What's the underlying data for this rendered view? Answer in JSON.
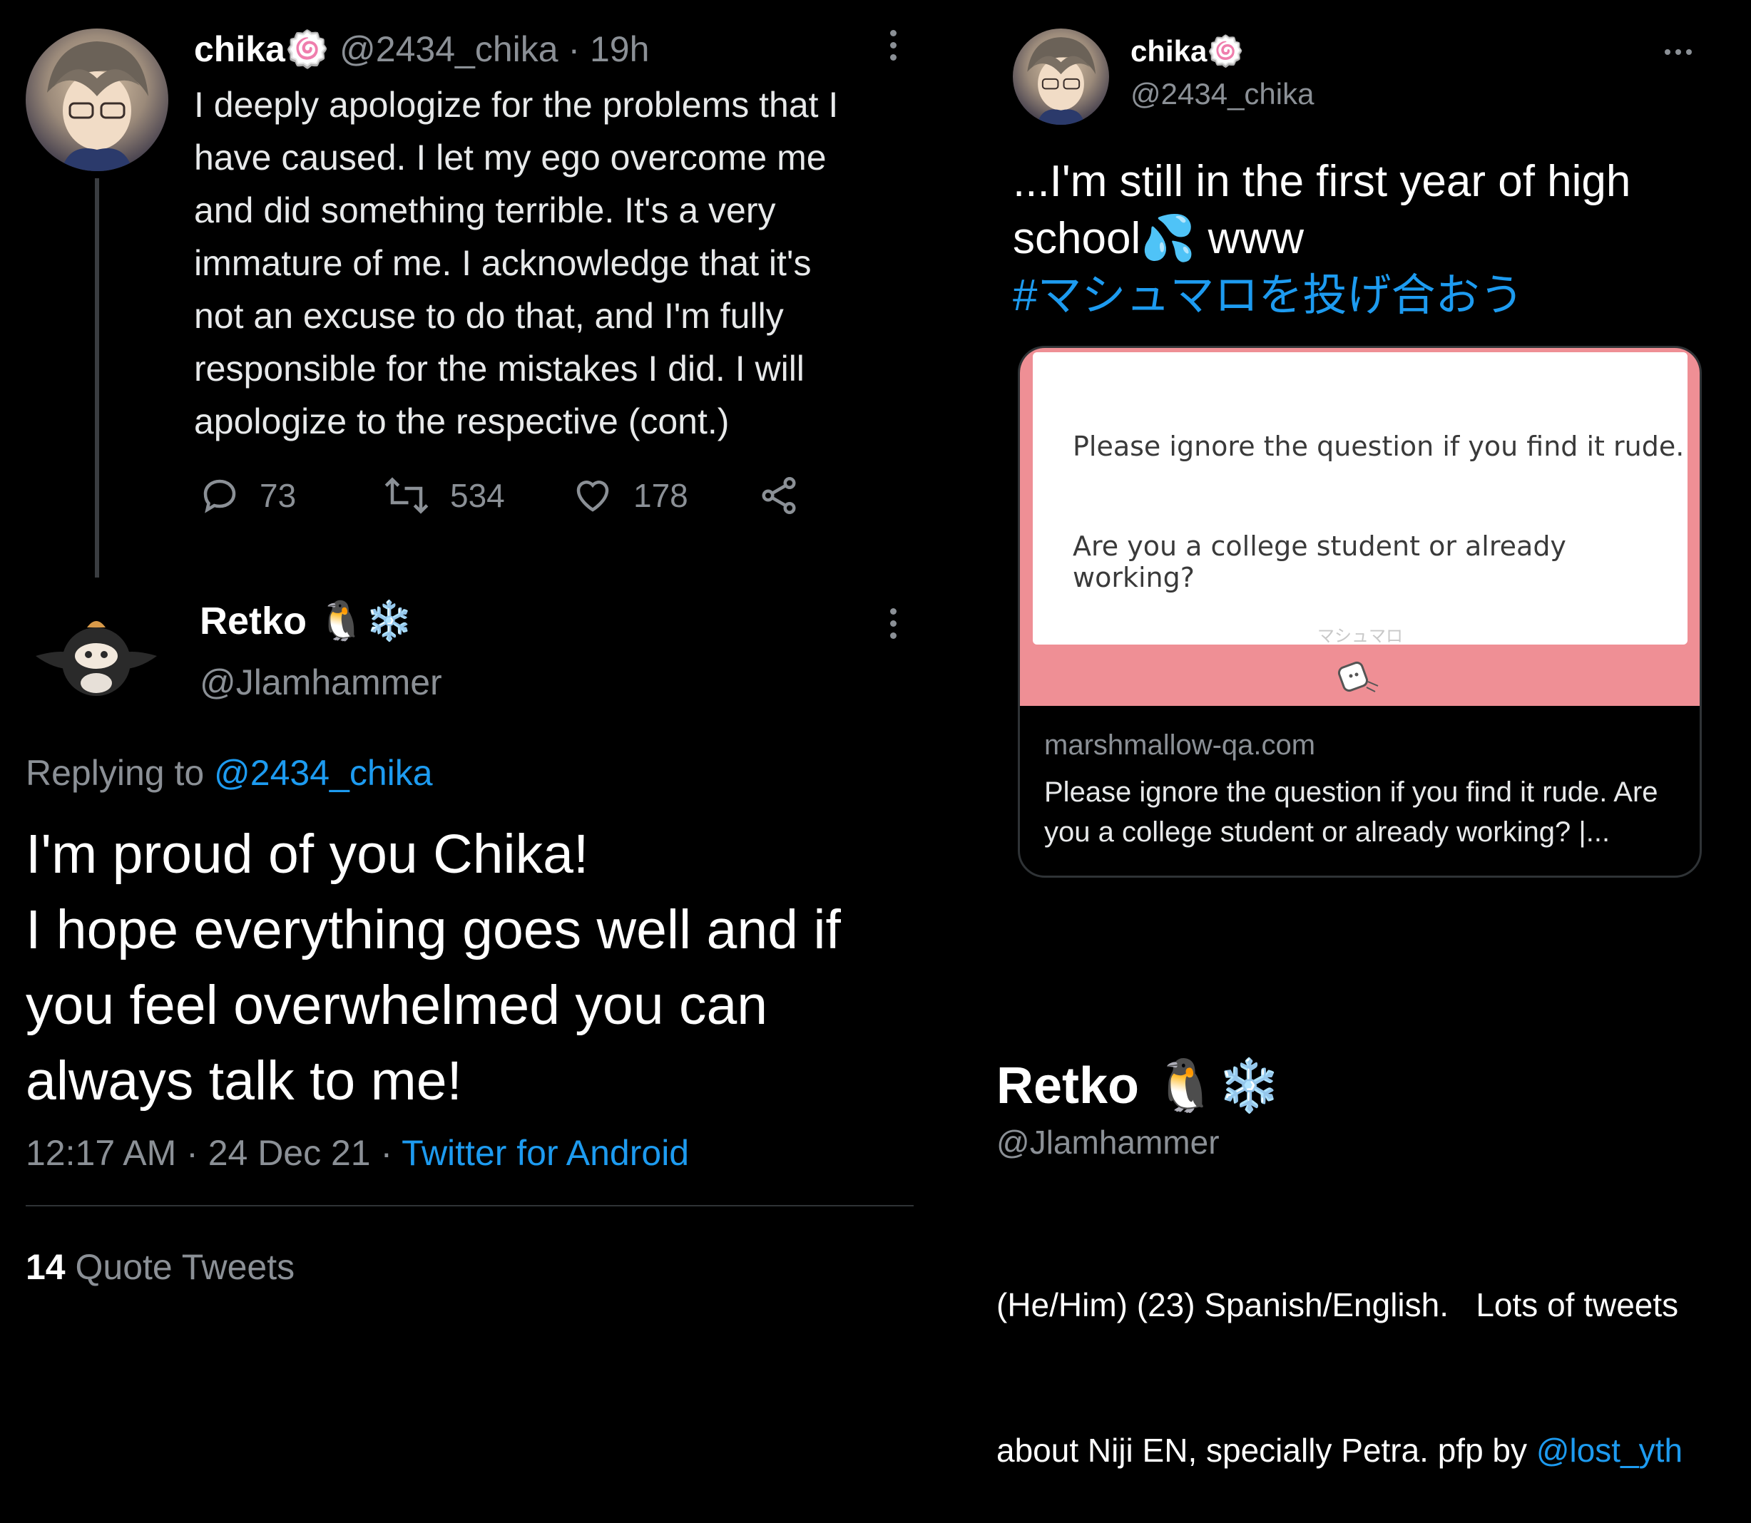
{
  "left_tweet": {
    "author_name": "chika",
    "author_emoji": "🍥",
    "handle": "@2434_chika",
    "time": " · 19h",
    "text_lines": [
      "I deeply apologize for the problems that I",
      "have caused. I let my ego overcome me",
      "and did something terrible. It's a very",
      "immature of me. I acknowledge that it's",
      "not an excuse to do that, and I'm fully",
      "responsible for the mistakes I did. I will",
      "apologize to the respective (cont.)"
    ],
    "replies": "73",
    "retweets": "534",
    "likes": "178"
  },
  "reply_tweet": {
    "author_name": "Retko",
    "author_emojis": "🐧❄️",
    "handle": "@Jlamhammer",
    "replying_prefix": "Replying to ",
    "replying_handle": "@2434_chika",
    "text_lines": [
      "I'm proud of you Chika!",
      "I hope everything goes well and if",
      "you feel overwhelmed you can",
      "always talk to me!"
    ],
    "timestamp": "12:17 AM · 24 Dec 21 · ",
    "client": "Twitter for Android",
    "quote_count": "14",
    "quote_label": " Quote Tweets"
  },
  "right_tweet": {
    "author_name": "chika",
    "author_emoji": "🍥",
    "handle": "@2434_chika",
    "text_line1": "...I'm still in the first year of high",
    "text_line2_a": "school",
    "text_line2_emoji": "💦",
    "text_line2_b": " www",
    "hashtag": "#マシュマロを投げ合おう",
    "card": {
      "question_1": "Please ignore the question if you find it rude.",
      "question_2": "Are you a college student or already working?",
      "brand": "マシュマロ",
      "domain": "marshmallow-qa.com",
      "desc_line1": "Please ignore the question if you find it rude. Are",
      "desc_line2": "you a college student or already working? |..."
    }
  },
  "profile": {
    "name": "Retko",
    "emojis": "🐧❄️",
    "handle": "@Jlamhammer",
    "bio_line1": "(He/Him) (23) Spanish/English.   Lots of tweets",
    "bio_line2_a": "about Niji EN, specially Petra. pfp by ",
    "bio_link": "@lost_yth"
  },
  "colors": {
    "background": "#000000",
    "link": "#1d9bf0",
    "muted": "#8b9096",
    "card_pink": "#ef8f95"
  }
}
